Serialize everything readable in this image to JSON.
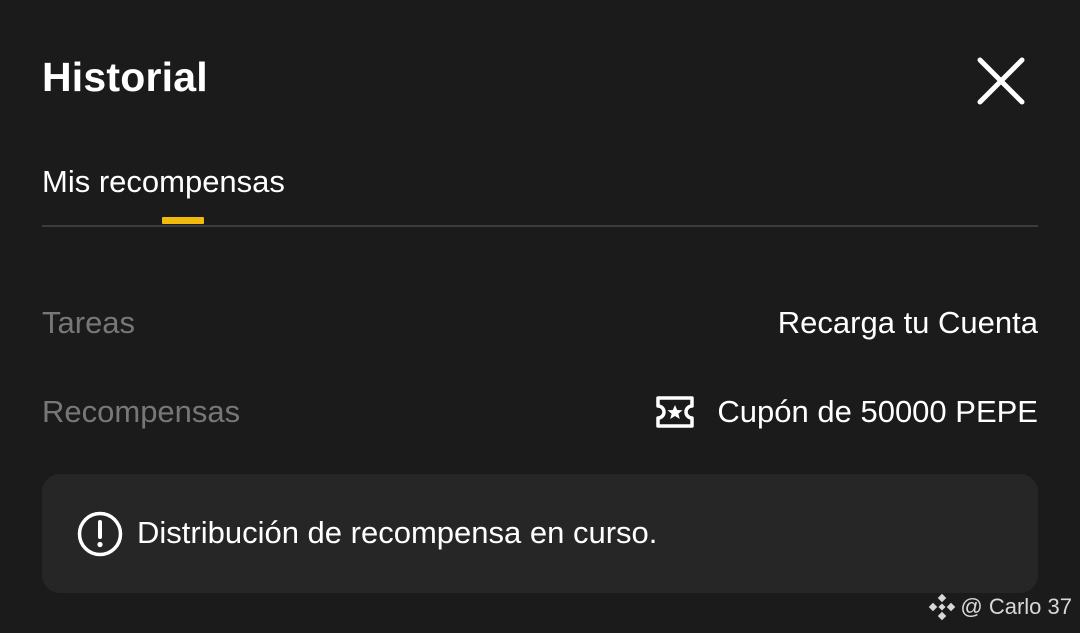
{
  "header": {
    "title": "Historial"
  },
  "tabs": [
    {
      "label": "Mis recompensas",
      "active": true
    }
  ],
  "details": {
    "task_label": "Tareas",
    "task_value": "Recarga tu Cuenta",
    "reward_label": "Recompensas",
    "reward_value": "Cupón de 50000 PEPE"
  },
  "notice": {
    "text": "Distribución de recompensa en curso."
  },
  "watermark": {
    "text": "@ Carlo 37"
  },
  "icons": {
    "close": "close-icon",
    "coupon": "coupon-ticket-icon",
    "info": "exclamation-circle-icon",
    "watermark_logo": "binance-logo-icon"
  },
  "colors": {
    "background": "#1b1b1b",
    "panel": "#262626",
    "accent": "#f0b90b",
    "muted_text": "#777777",
    "divider": "#3c3c3c"
  }
}
